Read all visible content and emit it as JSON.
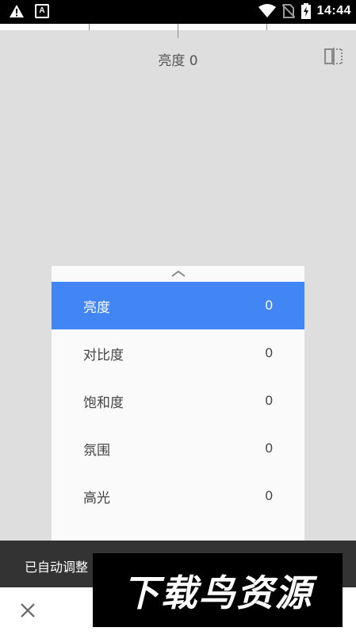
{
  "status_bar": {
    "time": "14:44",
    "left_icons": [
      "warning-icon",
      "a-badge-icon"
    ],
    "right_icons": [
      "wifi-icon",
      "no-sim-icon",
      "battery-charging-icon"
    ],
    "a_badge_letter": "A"
  },
  "adjust": {
    "title": "亮度 0"
  },
  "menu": {
    "items": [
      {
        "label": "亮度",
        "value": "0",
        "selected": true
      },
      {
        "label": "对比度",
        "value": "0",
        "selected": false
      },
      {
        "label": "饱和度",
        "value": "0",
        "selected": false
      },
      {
        "label": "氛围",
        "value": "0",
        "selected": false
      },
      {
        "label": "高光",
        "value": "0",
        "selected": false
      }
    ]
  },
  "snackbar": {
    "text": "已自动调整"
  },
  "watermark": {
    "text": "下载鸟资源"
  },
  "colors": {
    "accent": "#4285f4",
    "canvas": "#dedede",
    "snackbar": "#333333"
  }
}
